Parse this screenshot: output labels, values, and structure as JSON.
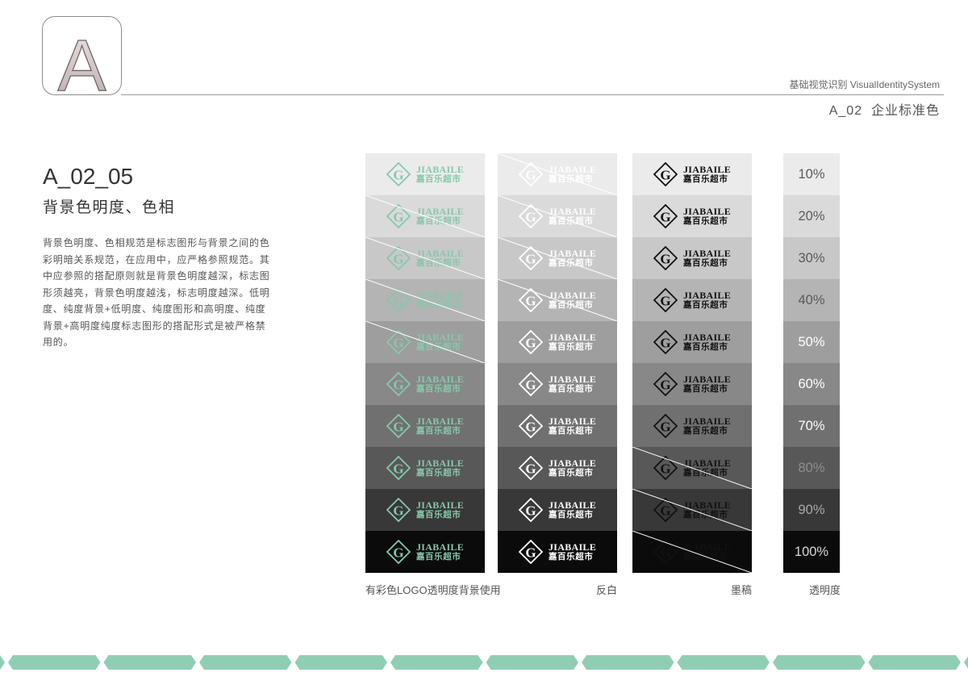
{
  "header": {
    "badge_letter": "A",
    "system_title": "基础视觉识别 VisualIdentitySystem",
    "section_title": "A_02  企业标准色"
  },
  "content": {
    "code": "A_02_05",
    "title": "背景色明度、色相",
    "description_lines": [
      "背景色明度、色相规范是标志图形与背景之间的色",
      "彩明暗关系规范，在应用中，应严格参照规范。其",
      "中应参照的搭配原则就是背景色明度越深，标志图",
      "形须越亮，背景色明度越浅，标志明度越深。低明",
      "度、纯度背景+低明度、纯度图形和高明度、纯度",
      "背景+高明度纯度标志图形的搭配形式是被严格禁",
      "用的。"
    ]
  },
  "logo": {
    "mark": "G",
    "name_en": "JIABAILE",
    "name_cn": "嘉百乐超市"
  },
  "levels": [
    {
      "label": "10%",
      "bg": "#ebebeb",
      "text": "#5a5a5a"
    },
    {
      "label": "20%",
      "bg": "#dadada",
      "text": "#5a5a5a"
    },
    {
      "label": "30%",
      "bg": "#c8c8c8",
      "text": "#5a5a5a"
    },
    {
      "label": "40%",
      "bg": "#b4b4b4",
      "text": "#5a5a5a"
    },
    {
      "label": "50%",
      "bg": "#9e9e9e",
      "text": "#ffffff"
    },
    {
      "label": "60%",
      "bg": "#888888",
      "text": "#ffffff"
    },
    {
      "label": "70%",
      "bg": "#707070",
      "text": "#ffffff"
    },
    {
      "label": "80%",
      "bg": "#585858",
      "text": "#8e8e8e"
    },
    {
      "label": "90%",
      "bg": "#383838",
      "text": "#a8a8a8"
    },
    {
      "label": "100%",
      "bg": "#0b0b0b",
      "text": "#d8d8d8"
    }
  ],
  "columns": [
    {
      "caption": "有彩色LOGO透明度背景使用",
      "logo_color": "#86c8ab",
      "crossed": [
        "20%",
        "30%",
        "40%",
        "50%"
      ]
    },
    {
      "caption": "反白",
      "logo_color": "#ffffff",
      "crossed": [
        "10%",
        "20%",
        "30%",
        "40%"
      ]
    },
    {
      "caption": "墨稿",
      "logo_color": "#111111",
      "crossed": [
        "80%",
        "90%",
        "100%"
      ]
    },
    {
      "caption": "透明度"
    }
  ],
  "colors": {
    "accent_green": "#90ceb4",
    "rule_grey": "#9a9a9a",
    "cross_line": "#ffffff",
    "badge_border": "#8c8c8c"
  }
}
